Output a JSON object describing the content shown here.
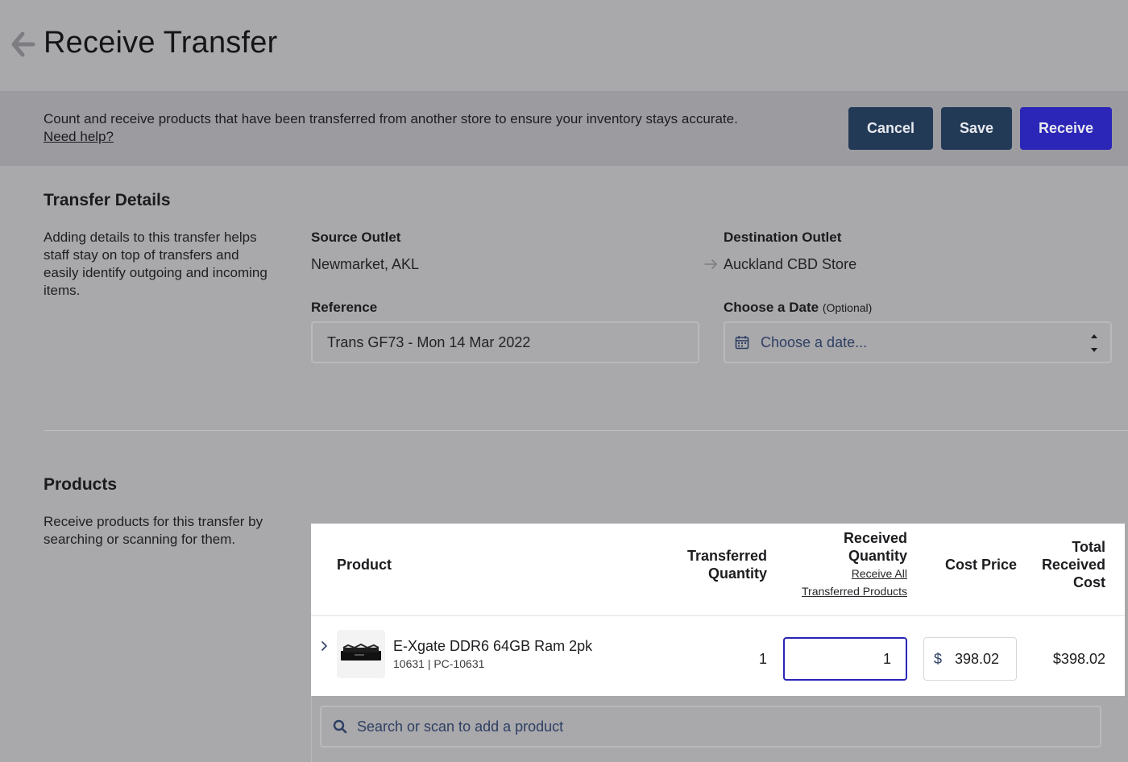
{
  "header": {
    "title": "Receive Transfer"
  },
  "banner": {
    "description": "Count and receive products that have been transferred from another store to ensure your inventory stays accurate.",
    "help_link": "Need help?",
    "cancel_label": "Cancel",
    "save_label": "Save",
    "receive_label": "Receive"
  },
  "transfer_details": {
    "title": "Transfer Details",
    "description": "Adding details to this transfer helps staff stay on top of transfers and easily identify outgoing and incoming items.",
    "source_label": "Source Outlet",
    "source_value": "Newmarket, AKL",
    "destination_label": "Destination Outlet",
    "destination_value": "Auckland CBD Store",
    "reference_label": "Reference",
    "reference_value": "Trans GF73 - Mon 14 Mar 2022",
    "date_label": "Choose a Date",
    "date_optional": "(Optional)",
    "date_placeholder": "Choose a date..."
  },
  "products": {
    "title": "Products",
    "description": "Receive products for this transfer by searching or scanning for them.",
    "columns": {
      "product": "Product",
      "transferred_line1": "Transferred",
      "transferred_line2": "Quantity",
      "received_line1": "Received",
      "received_line2": "Quantity",
      "receive_all_line1": "Receive All",
      "receive_all_line2": "Transferred Products",
      "cost": "Cost Price",
      "total_line1": "Total",
      "total_line2": "Received",
      "total_line3": "Cost"
    },
    "rows": [
      {
        "name": "E-Xgate DDR6 64GB Ram 2pk",
        "sku": "10631 | PC-10631",
        "transferred_qty": "1",
        "received_qty": "1",
        "currency_symbol": "$",
        "cost_price": "398.02",
        "total_cost": "$398.02"
      }
    ],
    "search_placeholder": "Search or scan to add a product"
  },
  "colors": {
    "background": "#a9a8ab",
    "banner": "#9c9ba0",
    "dark_button": "#233a57",
    "primary_button": "#2b25b8",
    "focus_border": "#2b25b8"
  }
}
